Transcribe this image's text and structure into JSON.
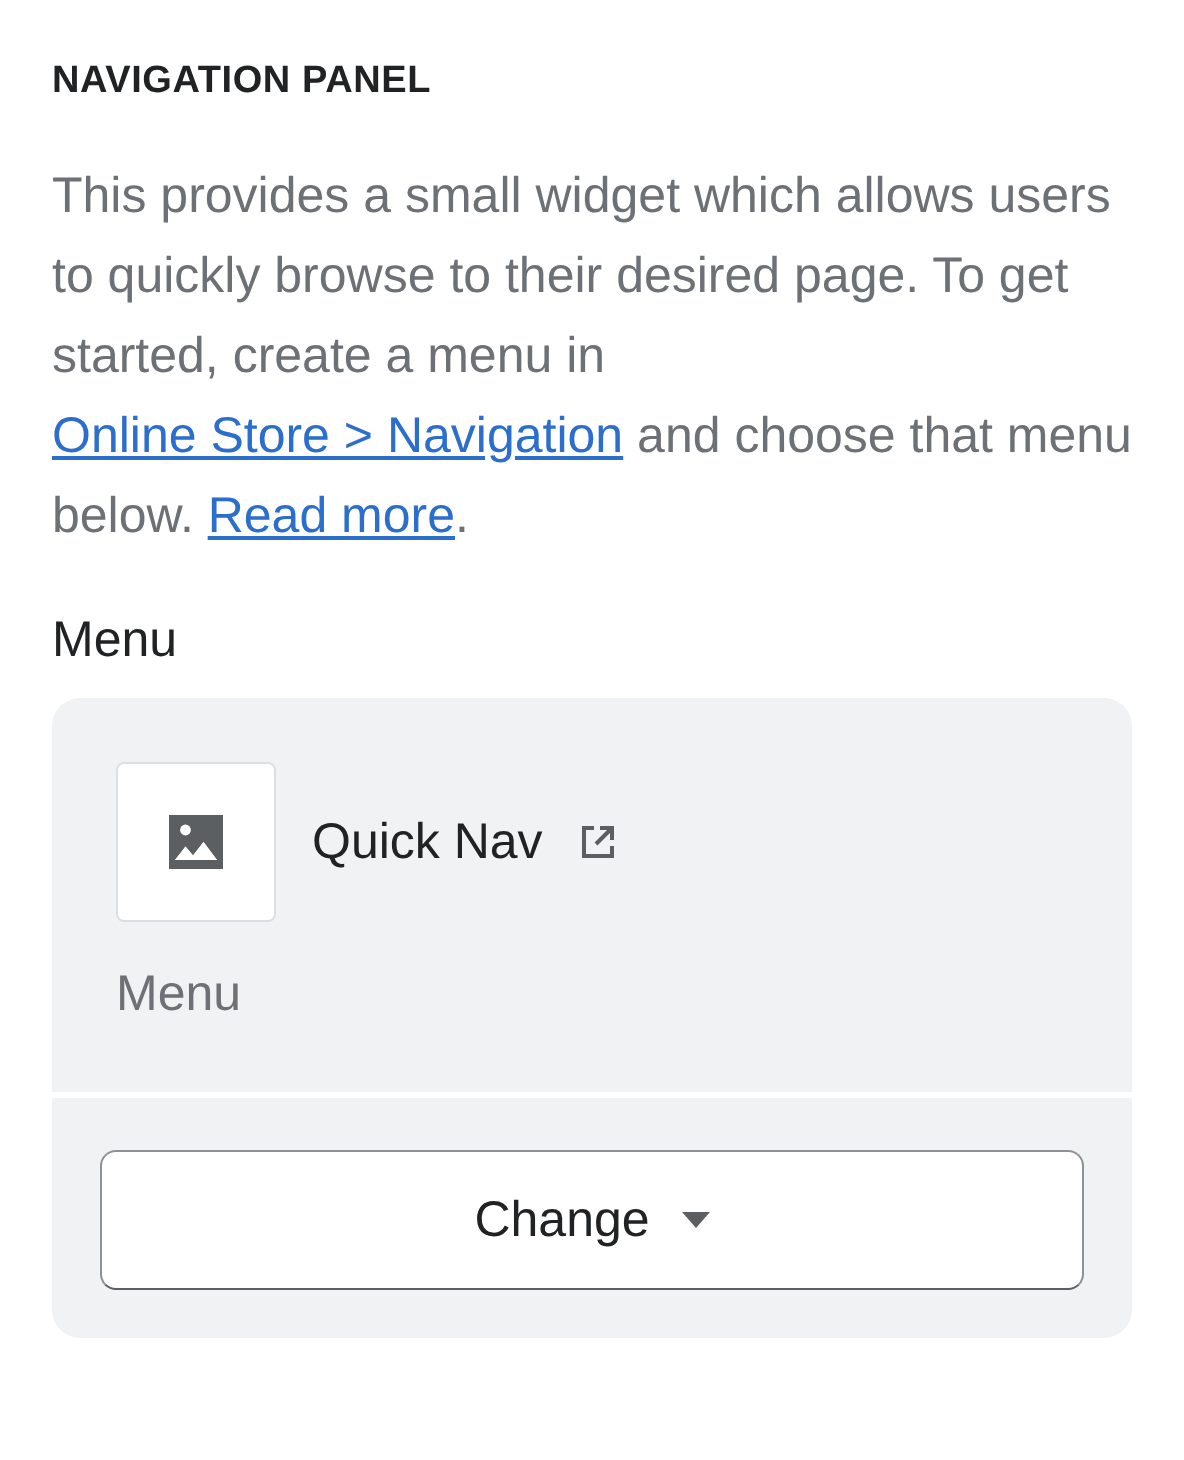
{
  "heading": "NAVIGATION PANEL",
  "description": [
    {
      "kind": "text",
      "text": "This provides a small widget which allows users to quickly browse to their desired page. To get started, create a menu in "
    },
    {
      "kind": "link",
      "text": "Online Store > Navigation"
    },
    {
      "kind": "text",
      "text": " and choose that menu below. "
    },
    {
      "kind": "link",
      "text": "Read more"
    },
    {
      "kind": "text",
      "text": "."
    }
  ],
  "menu_label": "Menu",
  "menu_card": {
    "name": "Quick Nav",
    "type": "Menu",
    "button": "Change"
  }
}
